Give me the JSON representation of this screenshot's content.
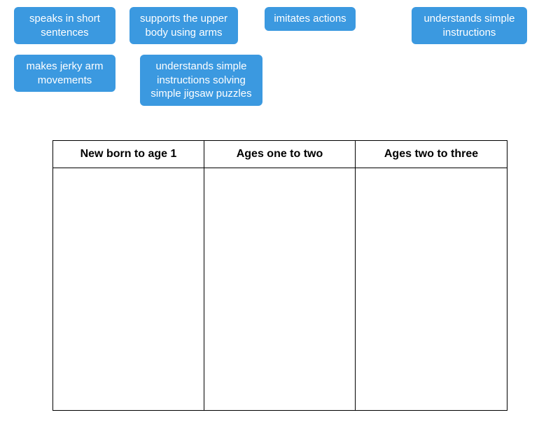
{
  "cards": [
    {
      "label": "speaks in short sentences"
    },
    {
      "label": "supports the upper body using arms"
    },
    {
      "label": "imitates actions"
    },
    {
      "label": "understands simple instructions"
    },
    {
      "label": "makes jerky arm movements"
    },
    {
      "label": "understands simple instructions solving simple jigsaw puzzles"
    }
  ],
  "columns": [
    {
      "header": "New born to age 1"
    },
    {
      "header": "Ages one to two"
    },
    {
      "header": "Ages two to three"
    }
  ]
}
